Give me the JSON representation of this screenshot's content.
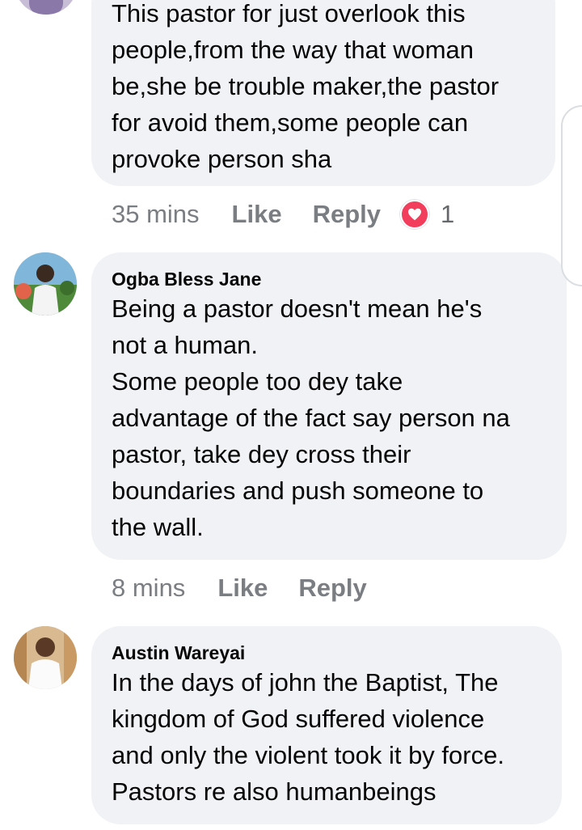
{
  "comments": [
    {
      "author": "",
      "text": "This pastor for just overlook this\npeople,from the way that woman\nbe,she be trouble maker,the pastor\nfor avoid them,some people can\nprovoke person sha",
      "time": "35 mins",
      "like_label": "Like",
      "reply_label": "Reply",
      "reaction_icon": "heart-icon",
      "reaction_count": "1"
    },
    {
      "author": "Ogba Bless Jane",
      "text": "Being a pastor doesn't mean he's\nnot a human.\nSome people too dey take\nadvantage of the fact say person na\npastor, take dey cross their\nboundaries and push someone to\nthe wall.",
      "time": "8 mins",
      "like_label": "Like",
      "reply_label": "Reply"
    },
    {
      "author": "Austin Wareyai",
      "text": "In the days of john the Baptist, The\nkingdom of God suffered violence\nand only the violent took it by force.\nPastors re also humanbeings"
    }
  ],
  "colors": {
    "bubble": "#f0f2f5",
    "meta_text": "#65676b",
    "reaction_heart": "#f23e5c"
  }
}
